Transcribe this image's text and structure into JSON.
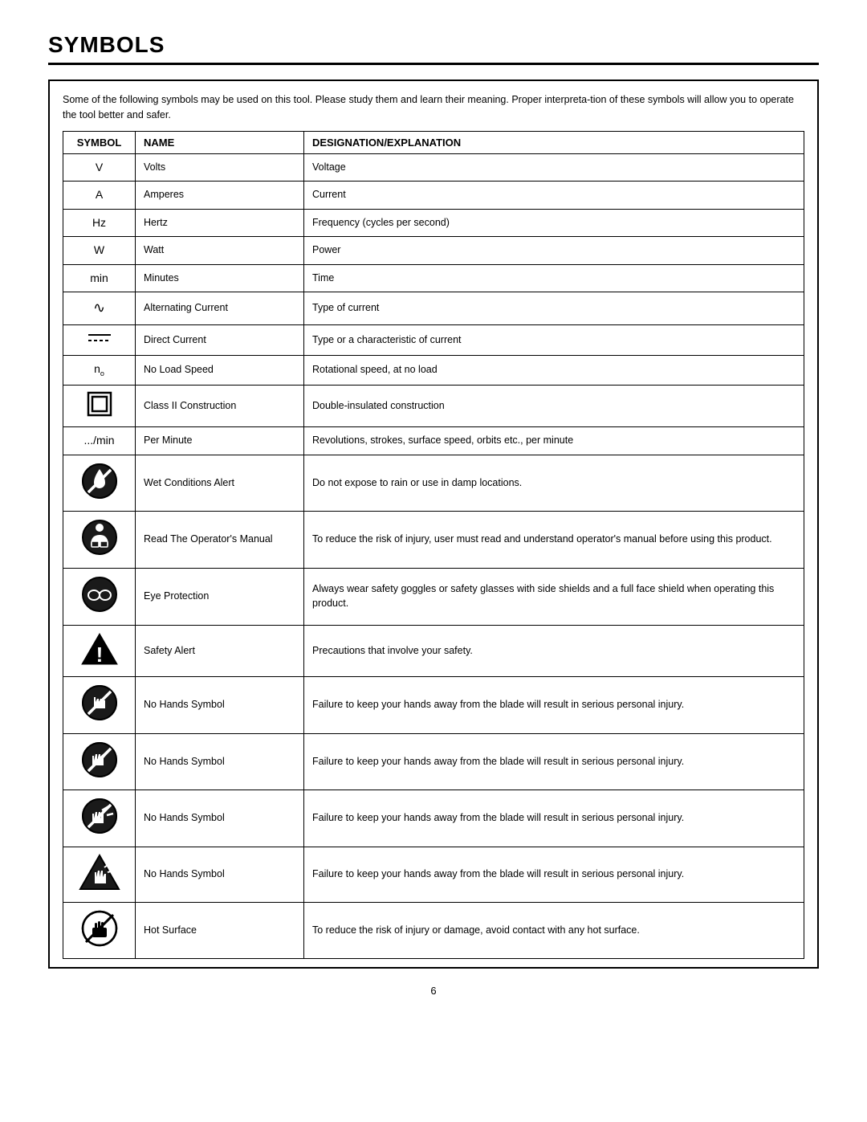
{
  "page": {
    "title": "SYMBOLS",
    "page_number": "6",
    "intro": "Some of the following symbols may be used on this tool. Please study them and learn their meaning. Proper interpreta-tion of these symbols will allow you to operate the tool better and safer.",
    "table": {
      "headers": [
        "SYMBOL",
        "NAME",
        "DESIGNATION/EXPLANATION"
      ],
      "rows": [
        {
          "symbol_text": "V",
          "symbol_type": "text",
          "name": "Volts",
          "explanation": "Voltage"
        },
        {
          "symbol_text": "A",
          "symbol_type": "text",
          "name": "Amperes",
          "explanation": "Current"
        },
        {
          "symbol_text": "Hz",
          "symbol_type": "text",
          "name": "Hertz",
          "explanation": "Frequency (cycles per second)"
        },
        {
          "symbol_text": "W",
          "symbol_type": "text",
          "name": "Watt",
          "explanation": "Power"
        },
        {
          "symbol_text": "min",
          "symbol_type": "text",
          "name": "Minutes",
          "explanation": "Time"
        },
        {
          "symbol_text": "∿",
          "symbol_type": "text",
          "name": "Alternating Current",
          "explanation": "Type of current"
        },
        {
          "symbol_text": "⎓",
          "symbol_type": "text",
          "name": "Direct Current",
          "explanation": "Type or a characteristic of current"
        },
        {
          "symbol_text": "n_o",
          "symbol_type": "subscript",
          "name": "No Load Speed",
          "explanation": "Rotational speed, at no load"
        },
        {
          "symbol_text": "class2",
          "symbol_type": "class2",
          "name": "Class II Construction",
          "explanation": "Double-insulated construction"
        },
        {
          "symbol_text": ".../min",
          "symbol_type": "text",
          "name": "Per Minute",
          "explanation": "Revolutions, strokes, surface speed, orbits etc., per minute"
        },
        {
          "symbol_text": "wet",
          "symbol_type": "wet",
          "name": "Wet Conditions Alert",
          "explanation": "Do not expose to rain or use in damp locations."
        },
        {
          "symbol_text": "manual",
          "symbol_type": "manual",
          "name": "Read The Operator's Manual",
          "explanation": "To reduce the risk of injury, user must read and understand operator's manual before using this product."
        },
        {
          "symbol_text": "eye",
          "symbol_type": "eye",
          "name": "Eye Protection",
          "explanation": "Always wear safety goggles or safety glasses with side shields and a full face shield when operating this product."
        },
        {
          "symbol_text": "alert",
          "symbol_type": "alert",
          "name": "Safety Alert",
          "explanation": "Precautions that involve your safety."
        },
        {
          "symbol_text": "nohands1",
          "symbol_type": "nohands1",
          "name": "No Hands Symbol",
          "explanation": "Failure to keep your hands away from the blade will result in serious personal injury."
        },
        {
          "symbol_text": "nohands2",
          "symbol_type": "nohands2",
          "name": "No Hands Symbol",
          "explanation": "Failure to keep your hands away from the blade will result in serious personal injury."
        },
        {
          "symbol_text": "nohands3",
          "symbol_type": "nohands3",
          "name": "No Hands Symbol",
          "explanation": "Failure to keep your hands away from the blade will result in serious personal injury."
        },
        {
          "symbol_text": "nohands4",
          "symbol_type": "nohands4",
          "name": "No Hands Symbol",
          "explanation": "Failure to keep your hands away from the blade will result in serious personal injury."
        },
        {
          "symbol_text": "hot",
          "symbol_type": "hot",
          "name": "Hot Surface",
          "explanation": "To reduce the risk of injury or damage, avoid contact with any hot surface."
        }
      ]
    }
  }
}
